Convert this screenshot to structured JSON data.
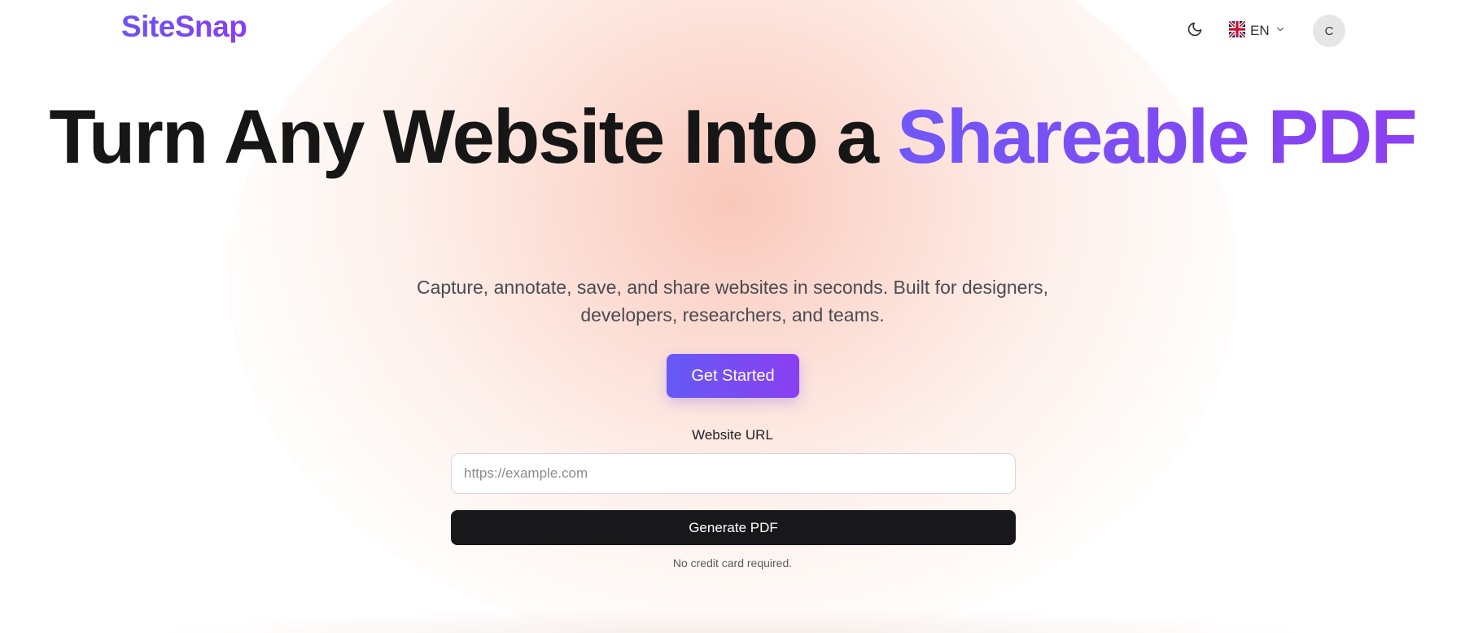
{
  "header": {
    "logo": "SiteSnap",
    "language_code": "EN",
    "avatar_initial": "C"
  },
  "hero": {
    "headline_part1": "Turn Any Website Into a ",
    "headline_accent": "Shareable PDF",
    "subtitle": "Capture, annotate, save, and share websites in seconds. Built for designers, developers, researchers, and teams.",
    "cta_label": "Get Started"
  },
  "form": {
    "url_label": "Website URL",
    "url_value": "",
    "url_placeholder": "https://example.com",
    "generate_label": "Generate PDF",
    "note": "No credit card required."
  },
  "colors": {
    "accent_start": "#6b54f5",
    "accent_end": "#8b3df0",
    "dark_button": "#18181b",
    "glow": "#f8beaf"
  },
  "icons": {
    "theme_toggle": "moon-icon",
    "language_flag": "uk-flag-icon",
    "language_dropdown": "chevron-down-icon"
  }
}
